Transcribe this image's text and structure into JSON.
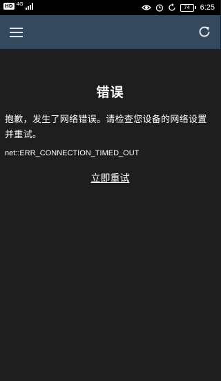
{
  "status_bar": {
    "network_type": "4G",
    "battery_level": "74",
    "time": "6:25",
    "icons": [
      "hd-icon",
      "signal-icon",
      "eye-icon",
      "alarm-icon",
      "sync-icon",
      "battery-icon"
    ]
  },
  "app_bar": {
    "background_color": "#34495e",
    "left_icon": "hamburger-menu-icon",
    "right_icon": "refresh-icon"
  },
  "error": {
    "title": "错误",
    "message": "抱歉，发生了网络错误。请检查您设备的网络设置并重试。",
    "code": "net::ERR_CONNECTION_TIMED_OUT",
    "retry_label": "立即重试"
  }
}
